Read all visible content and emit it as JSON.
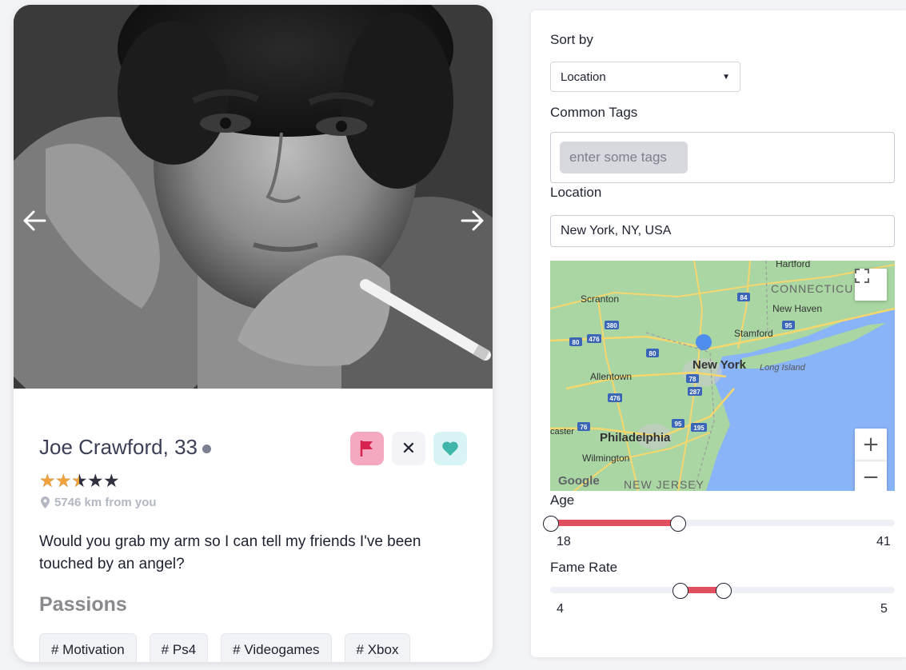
{
  "profile": {
    "name_age": "Joe Crawford, 33",
    "rating": 2.5,
    "rating_max": 5,
    "distance": "5746 km from you",
    "bio": "Would you grab my arm so I can tell my friends I've been touched by an angel?",
    "passions_title": "Passions",
    "passions": [
      "# Motivation",
      "# Ps4",
      "# Videogames",
      "# Xbox"
    ],
    "actions": {
      "report_icon": "flag-icon",
      "dislike_label": "✕",
      "like_icon": "heart-icon"
    },
    "colors": {
      "report_bg": "#f4a9c0",
      "report_icon": "#d6234f",
      "like_bg": "#d8f4f4",
      "like_icon": "#3fb6a9",
      "star": "#f0a23b"
    }
  },
  "filters": {
    "sort_by_label": "Sort by",
    "sort_value": "Location",
    "common_tags_label": "Common Tags",
    "tags_placeholder": "enter some tags",
    "location_label": "Location",
    "location_value": "New York, NY, USA",
    "map": {
      "labels": {
        "hartford": "Hartford",
        "connecticut": "CONNECTICU",
        "scranton": "Scranton",
        "new_haven": "New Haven",
        "stamford": "Stamford",
        "new_york": "New York",
        "long_island": "Long Island",
        "allentown": "Allentown",
        "philadelphia": "Philadelphia",
        "lancaster": "caster",
        "wilmington": "Wilmington",
        "new_jersey": "NEW JERSEY",
        "google": "Google"
      },
      "shields": [
        "84",
        "380",
        "476",
        "80",
        "80",
        "95",
        "78",
        "287",
        "476",
        "76",
        "95",
        "195"
      ],
      "zoom_in": "+",
      "zoom_out": "−"
    },
    "age": {
      "label": "Age",
      "min": 18,
      "max": 41,
      "low": 18,
      "high": 26.5
    },
    "fame": {
      "label": "Fame Rate",
      "min": 4,
      "max": 5,
      "low": 4.375,
      "high": 4.5
    }
  }
}
